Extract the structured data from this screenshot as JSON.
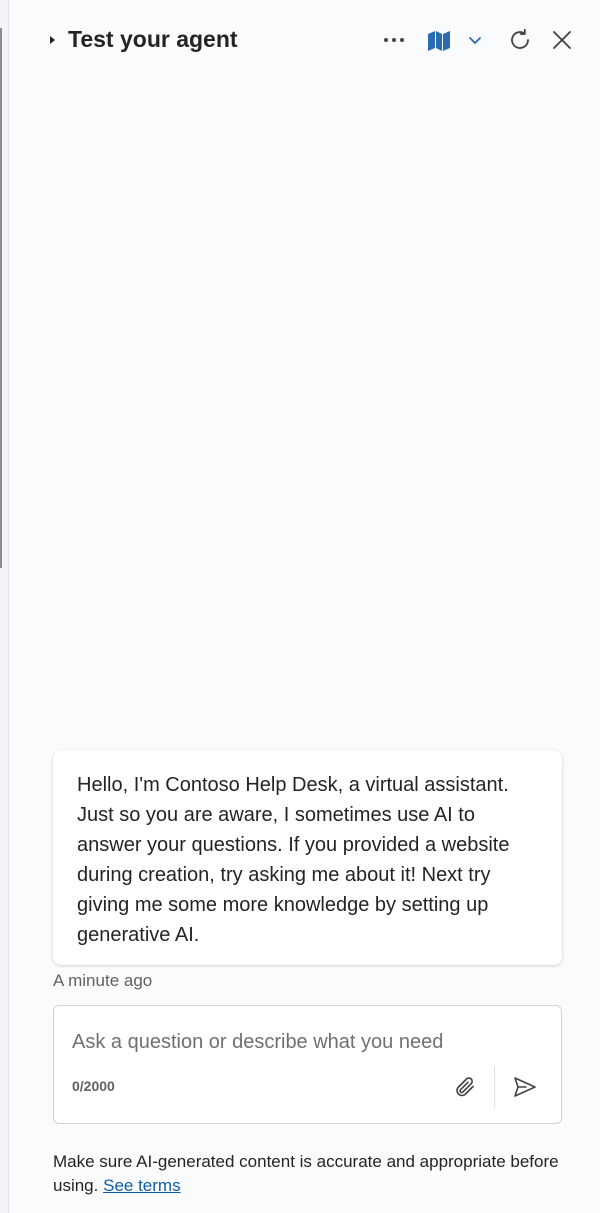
{
  "header": {
    "title": "Test your agent",
    "icons": {
      "collapse": "caret-right-icon",
      "more": "more-horizontal-icon",
      "map": "map-icon",
      "dropdown": "chevron-down-icon",
      "refresh": "refresh-icon",
      "close": "close-icon"
    }
  },
  "messages": [
    {
      "from": "bot",
      "text": "Hello, I'm Contoso Help Desk, a virtual assistant. Just so you are aware, I sometimes use AI to answer your questions. If you provided a website during creation, try asking me about it! Next try giving me some more knowledge by setting up generative AI.",
      "timestamp": "A minute ago"
    }
  ],
  "composer": {
    "placeholder": "Ask a question or describe what you need",
    "value": "",
    "counter": "0/2000",
    "icons": {
      "attach": "paperclip-icon",
      "send": "send-icon"
    }
  },
  "disclaimer": {
    "text": "Make sure AI-generated content is accurate and appropriate before using.",
    "link_label": "See terms"
  },
  "colors": {
    "accent": "#2b6cb0",
    "link": "#115ea3",
    "panel_background": "#fafbfd"
  }
}
